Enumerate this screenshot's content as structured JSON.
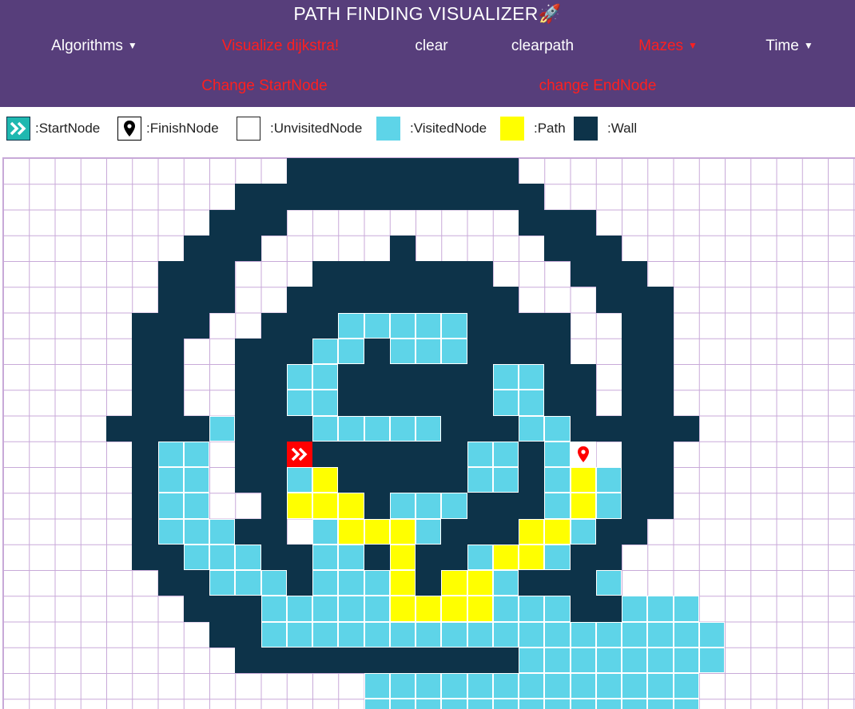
{
  "header": {
    "title": "PATH FINDING VISUALIZER🚀",
    "nav": [
      {
        "label": "Algorithms",
        "dropdown": true,
        "color": "#ffffff"
      },
      {
        "label": "Visualize dijkstra!",
        "dropdown": false,
        "color": "#ff1f1f"
      },
      {
        "label": "clear",
        "dropdown": false,
        "color": "#ffffff"
      },
      {
        "label": "clearpath",
        "dropdown": false,
        "color": "#ffffff"
      },
      {
        "label": "Mazes",
        "dropdown": true,
        "color": "#ff1f1f"
      },
      {
        "label": "Time",
        "dropdown": true,
        "color": "#ffffff"
      }
    ],
    "nav2": [
      {
        "label": "Change StartNode",
        "color": "#ff1f1f"
      },
      {
        "label": "change EndNode",
        "color": "#ff1f1f"
      }
    ]
  },
  "legend": [
    {
      "label": ":StartNode",
      "icon": "start-arrows-icon"
    },
    {
      "label": ":FinishNode",
      "icon": "map-pin-icon"
    },
    {
      "label": ":UnvisitedNode",
      "color": "#ffffff"
    },
    {
      "label": ":VisitedNode",
      "color": "#5ed4e8"
    },
    {
      "label": ":Path",
      "color": "#ffff00"
    },
    {
      "label": ":Wall",
      "color": "#0d3349"
    }
  ],
  "colors": {
    "header_bg": "#573e7b",
    "wall": "#0d3349",
    "visited": "#5ed4e8",
    "path": "#ffff00",
    "start": "#ff0000",
    "grid_line": "#c8a9d8"
  },
  "grid": {
    "cols": 33,
    "rows": 22,
    "start": [
      11,
      11
    ],
    "finish": [
      22,
      11
    ],
    "rows_data": [
      "...........#########.............",
      ".........############............",
      "........###.........###..........",
      ".......###.....#.....###.........",
      "......###...#######...###........",
      "......###..#########...###.......",
      ".....###..###vvvvv####..##.......",
      ".....##..###vv#vvv####..##.......",
      ".....##..##vv######vv##.##.......",
      ".....##..##vv######vv##.##.......",
      "....####v###vvvvv###vv#####......",
      ".....#vv.##S######vv#vv.##.......",
      ".....#vv.##vP#####vv#vPv##.......",
      ".....#vv..#PPP#vvv###vPv##.......",
      ".....#vvv##.vPPPv###PPv##........",
      ".....##vvv##vv#P##vPPv##.........",
      "......##vvv#vvvP#PPv###v.........",
      ".......###vvvvvPPPPvvv##vvv......",
      "........##vvvvvvvvvvvvvvvvvv.....",
      ".........###########vvvvvvvv.....",
      "..............vvvvvvvvvvvvv......",
      "..............vvvvvvvvvvvvv......"
    ]
  }
}
